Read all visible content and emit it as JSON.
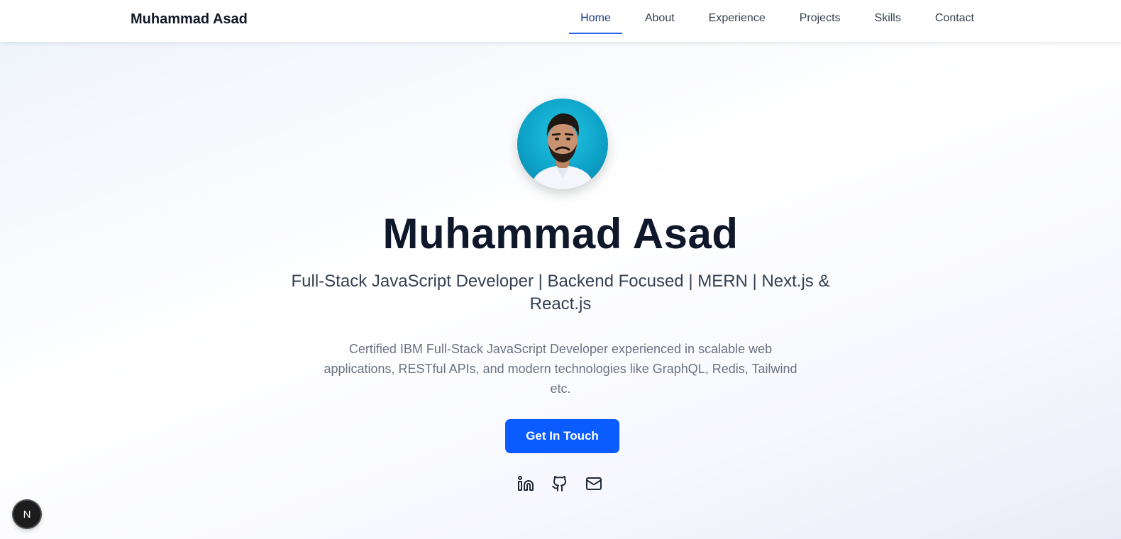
{
  "header": {
    "brand": "Muhammad Asad",
    "nav": [
      {
        "label": "Home",
        "active": true
      },
      {
        "label": "About"
      },
      {
        "label": "Experience"
      },
      {
        "label": "Projects"
      },
      {
        "label": "Skills"
      },
      {
        "label": "Contact"
      }
    ]
  },
  "hero": {
    "avatar_alt": "profile-photo",
    "name": "Muhammad Asad",
    "tagline": "Full-Stack JavaScript Developer | Backend Focused | MERN | Next.js & React.js",
    "description": "Certified IBM Full-Stack JavaScript Developer experienced in scalable web applications, RESTful APIs, and modern technologies like GraphQL, Redis, Tailwind etc.",
    "cta_label": "Get In Touch",
    "socials": [
      {
        "icon": "linkedin-icon"
      },
      {
        "icon": "github-icon"
      },
      {
        "icon": "mail-icon"
      }
    ]
  },
  "dev_badge": {
    "label": "N"
  },
  "colors": {
    "accent": "#0a5cff",
    "active_underline": "#2563eb",
    "heading": "#0f172a",
    "text": "#374151",
    "muted": "#6b7280"
  }
}
